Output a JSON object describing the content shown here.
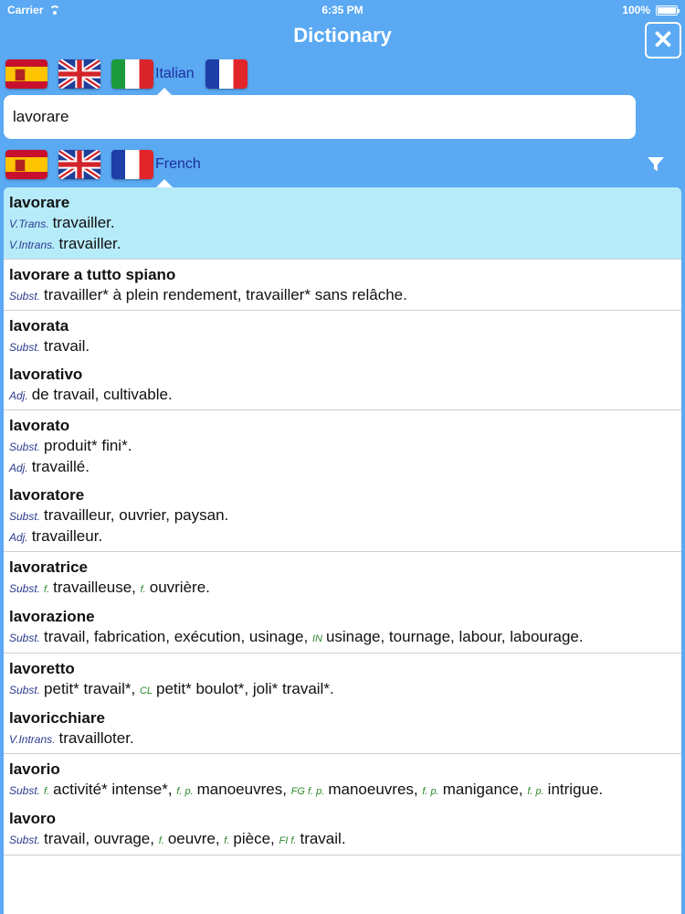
{
  "status_bar": {
    "carrier": "Carrier",
    "time": "6:35 PM",
    "battery": "100%"
  },
  "nav": {
    "title": "Dictionary",
    "close_glyph": "✕"
  },
  "source_lang": {
    "label": "Italian",
    "flags": [
      "spain-flag-icon",
      "uk-flag-icon",
      "italy-flag-icon",
      "france-flag-icon"
    ]
  },
  "search": {
    "value": "lavorare"
  },
  "target_lang": {
    "label": "French",
    "flags": [
      "spain-flag-icon",
      "uk-flag-icon",
      "france-flag-icon"
    ]
  },
  "results": [
    {
      "selected": true,
      "entries": [
        {
          "word": "lavorare",
          "senses": [
            {
              "pos": "V.Trans.",
              "text": "travailler."
            },
            {
              "pos": "V.Intrans.",
              "text": "travailler."
            }
          ]
        }
      ]
    },
    {
      "entries": [
        {
          "word": "lavorare a tutto spiano",
          "senses": [
            {
              "pos": "Subst.",
              "text": "travailler* à plein rendement, travailler* sans relâche."
            }
          ]
        }
      ]
    },
    {
      "entries": [
        {
          "word": "lavorata",
          "senses": [
            {
              "pos": "Subst.",
              "text": "travail."
            }
          ]
        },
        {
          "word": "lavorativo",
          "senses": [
            {
              "pos": "Adj.",
              "text": "de travail, cultivable."
            }
          ]
        }
      ]
    },
    {
      "entries": [
        {
          "word": "lavorato",
          "senses": [
            {
              "pos": "Subst.",
              "text": "produit* fini*."
            },
            {
              "pos": "Adj.",
              "text": "travaillé."
            }
          ]
        },
        {
          "word": "lavoratore",
          "senses": [
            {
              "pos": "Subst.",
              "text": "travailleur, ouvrier, paysan."
            },
            {
              "pos": "Adj.",
              "text": "travailleur."
            }
          ]
        }
      ]
    },
    {
      "entries": [
        {
          "word": "lavoratrice",
          "senses": [
            {
              "parts": [
                {
                  "pos": "Subst."
                },
                {
                  "tag": "f."
                },
                {
                  "text": "travailleuse,"
                },
                {
                  "tag": "f."
                },
                {
                  "text": "ouvrière."
                }
              ]
            }
          ]
        },
        {
          "word": "lavorazione",
          "senses": [
            {
              "parts": [
                {
                  "pos": "Subst."
                },
                {
                  "text": "travail, fabrication, exécution, usinage,"
                },
                {
                  "tag": "IN"
                },
                {
                  "text": "usinage, tournage, labour, labourage."
                }
              ]
            }
          ]
        }
      ]
    },
    {
      "entries": [
        {
          "word": "lavoretto",
          "senses": [
            {
              "parts": [
                {
                  "pos": "Subst."
                },
                {
                  "text": "petit* travail*,"
                },
                {
                  "tag": "CL"
                },
                {
                  "text": "petit* boulot*, joli* travail*."
                }
              ]
            }
          ]
        },
        {
          "word": "lavoricchiare",
          "senses": [
            {
              "pos": "V.Intrans.",
              "text": "travailloter."
            }
          ]
        }
      ]
    },
    {
      "entries": [
        {
          "word": "lavorio",
          "senses": [
            {
              "parts": [
                {
                  "pos": "Subst."
                },
                {
                  "tag": "f."
                },
                {
                  "text": "activité* intense*,"
                },
                {
                  "tag": "f. p."
                },
                {
                  "text": "manoeuvres,"
                },
                {
                  "tag": "FG f. p."
                },
                {
                  "text": "manoeuvres,"
                },
                {
                  "tag": "f. p."
                },
                {
                  "text": "manigance,"
                },
                {
                  "tag": "f. p."
                },
                {
                  "text": "intrigue."
                }
              ]
            }
          ]
        },
        {
          "word": "lavoro",
          "senses": [
            {
              "parts": [
                {
                  "pos": "Subst."
                },
                {
                  "text": "travail, ouvrage,"
                },
                {
                  "tag": "f."
                },
                {
                  "text": "oeuvre,"
                },
                {
                  "tag": "f."
                },
                {
                  "text": "pièce,"
                },
                {
                  "tag": "FI f."
                },
                {
                  "text": "travail."
                }
              ]
            }
          ]
        }
      ]
    }
  ]
}
